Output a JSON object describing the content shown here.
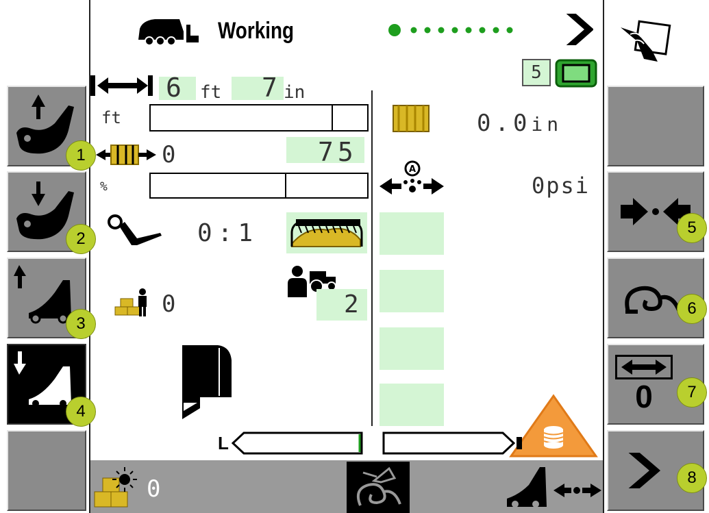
{
  "header": {
    "title": "Working",
    "status_dots": 8,
    "screen_number": "5"
  },
  "bale": {
    "length_ft": "6",
    "length_ft_unit": "ft",
    "length_in": "7",
    "length_in_unit": "in",
    "ft_label": "ft",
    "count_value": "0",
    "count_target": "75",
    "percent_label": "%",
    "ratio": "0:1",
    "bales_operator": "0",
    "bales_tractor": "2",
    "moisture_value": "0.0",
    "moisture_unit": "in",
    "pressure": "0psi"
  },
  "bottom": {
    "bottom_left_value": "0",
    "left_label": "L"
  },
  "softkeys": {
    "left": [
      "raise-pickup",
      "lower-pickup",
      "raise-gate",
      "lower-gate",
      "empty"
    ],
    "right": [
      "eject-compress",
      "knotter",
      "length-adjust",
      "next-page"
    ],
    "length_adjust_value": "0"
  },
  "badges": [
    "1",
    "2",
    "3",
    "4",
    "5",
    "6",
    "7",
    "8"
  ],
  "colors": {
    "accent_green": "#1e9e1e",
    "lcd_green": "#d4f5d4",
    "softkey_gray": "#8b8b8b",
    "badge_yellow": "#b9cf2e",
    "warning_orange": "#f39a3b"
  }
}
